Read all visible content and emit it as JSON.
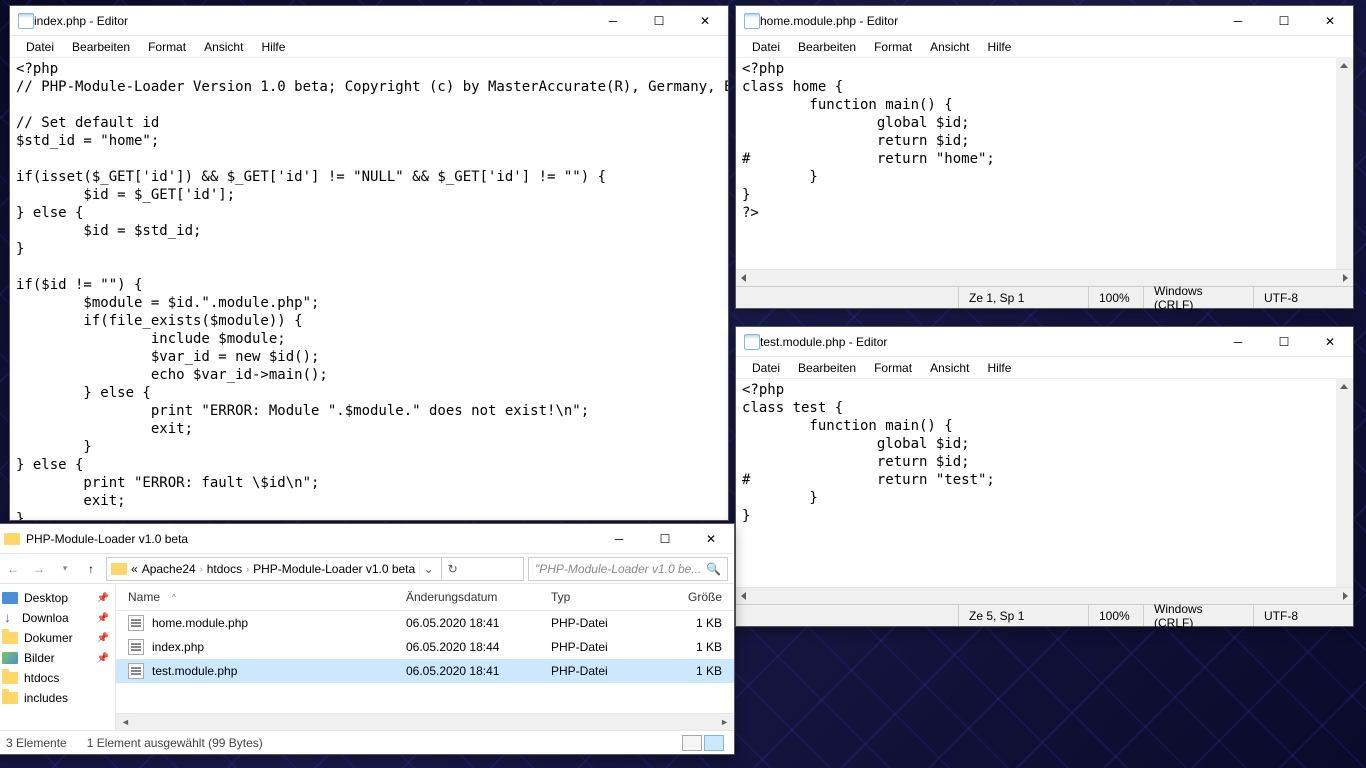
{
  "menus": {
    "datei": "Datei",
    "bearbeiten": "Bearbeiten",
    "format": "Format",
    "ansicht": "Ansicht",
    "hilfe": "Hilfe"
  },
  "editor1": {
    "title": "index.php - Editor",
    "content": "<?php\n// PHP-Module-Loader Version 1.0 beta; Copyright (c) by MasterAccurate(R), Germany, EU\n\n// Set default id\n$std_id = \"home\";\n\nif(isset($_GET['id']) && $_GET['id'] != \"NULL\" && $_GET['id'] != \"\") {\n        $id = $_GET['id'];\n} else {\n        $id = $std_id;\n}\n\nif($id != \"\") {\n        $module = $id.\".module.php\";\n        if(file_exists($module)) {\n                include $module;\n                $var_id = new $id();\n                echo $var_id->main();\n        } else {\n                print \"ERROR: Module \".$module.\" does not exist!\\n\";\n                exit;\n        }\n} else {\n        print \"ERROR: fault \\$id\\n\";\n        exit;\n}"
  },
  "editor2": {
    "title": "home.module.php - Editor",
    "content": "<?php\nclass home {\n        function main() {\n                global $id;\n                return $id;\n#               return \"home\";\n        }\n}\n?>",
    "status": {
      "pos": "Ze 1, Sp 1",
      "zoom": "100%",
      "eol": "Windows (CRLF)",
      "enc": "UTF-8"
    }
  },
  "editor3": {
    "title": "test.module.php - Editor",
    "content": "<?php\nclass test {\n        function main() {\n                global $id;\n                return $id;\n#               return \"test\";\n        }\n}",
    "status": {
      "pos": "Ze 5, Sp 1",
      "zoom": "100%",
      "eol": "Windows (CRLF)",
      "enc": "UTF-8"
    }
  },
  "explorer": {
    "title": "PHP-Module-Loader v1.0 beta",
    "breadcrumb_prefix": "«",
    "breadcrumbs": [
      "Apache24",
      "htdocs",
      "PHP-Module-Loader v1.0 beta"
    ],
    "search_placeholder": "\"PHP-Module-Loader v1.0 be...",
    "sidebar": [
      {
        "label": "Desktop",
        "icon": "desktop",
        "pinned": true
      },
      {
        "label": "Downloa",
        "icon": "download",
        "pinned": true
      },
      {
        "label": "Dokumer",
        "icon": "folder",
        "pinned": true
      },
      {
        "label": "Bilder",
        "icon": "pic",
        "pinned": true
      },
      {
        "label": "htdocs",
        "icon": "folder",
        "pinned": false
      },
      {
        "label": "includes",
        "icon": "folder",
        "pinned": false
      }
    ],
    "columns": {
      "name": "Name",
      "date": "Änderungsdatum",
      "type": "Typ",
      "size": "Größe"
    },
    "files": [
      {
        "name": "home.module.php",
        "date": "06.05.2020 18:41",
        "type": "PHP-Datei",
        "size": "1 KB",
        "selected": false
      },
      {
        "name": "index.php",
        "date": "06.05.2020 18:44",
        "type": "PHP-Datei",
        "size": "1 KB",
        "selected": false
      },
      {
        "name": "test.module.php",
        "date": "06.05.2020 18:41",
        "type": "PHP-Datei",
        "size": "1 KB",
        "selected": true
      }
    ],
    "status_left": "3 Elemente",
    "status_sel": "1 Element ausgewählt (99 Bytes)"
  }
}
